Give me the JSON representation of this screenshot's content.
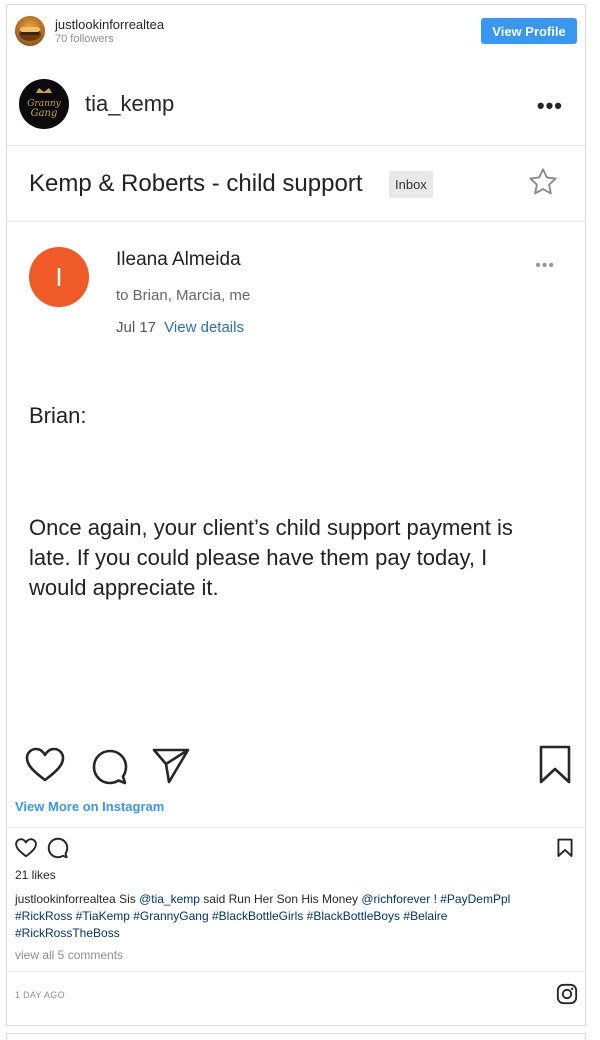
{
  "header": {
    "username": "justlookinforrealtea",
    "followers": "70 followers",
    "view_profile_label": "View Profile"
  },
  "post_image": {
    "account_name": "tia_kemp",
    "avatar_text": "Granny Gang",
    "email": {
      "subject": "Kemp & Roberts - child support",
      "label_badge": "Inbox",
      "sender_initial": "I",
      "sender_name": "Ileana Almeida",
      "recipients": "to Brian, Marcia, me",
      "date": "Jul 17",
      "view_details": "View details",
      "greeting": "Brian:",
      "body": "Once again, your client’s child support payment is late.  If you could please have them pay today, I would appreciate it."
    }
  },
  "embed": {
    "view_more_label": "View More on Instagram",
    "likes": "21 likes",
    "caption_user": "justlookinforrealtea",
    "caption_text_1": " Sis ",
    "mention_1": "@tia_kemp",
    "caption_text_2": " said Run Her Son His Money ",
    "mention_2": "@richforever",
    "caption_text_3": " ! ",
    "hashtags_line1": "#PayDemPpl",
    "hashtags_line2": "#RickRoss #TiaKemp #GrannyGang #BlackBottleGirls #BlackBottleBoys #Belaire",
    "hashtags_line3": "#RickRossTheBoss",
    "view_comments": "view all 5 comments",
    "timestamp": "1 day ago"
  },
  "colors": {
    "accent_blue": "#3897f0",
    "link_blue": "#2b6fb6",
    "sender_avatar": "#ef5a26"
  }
}
